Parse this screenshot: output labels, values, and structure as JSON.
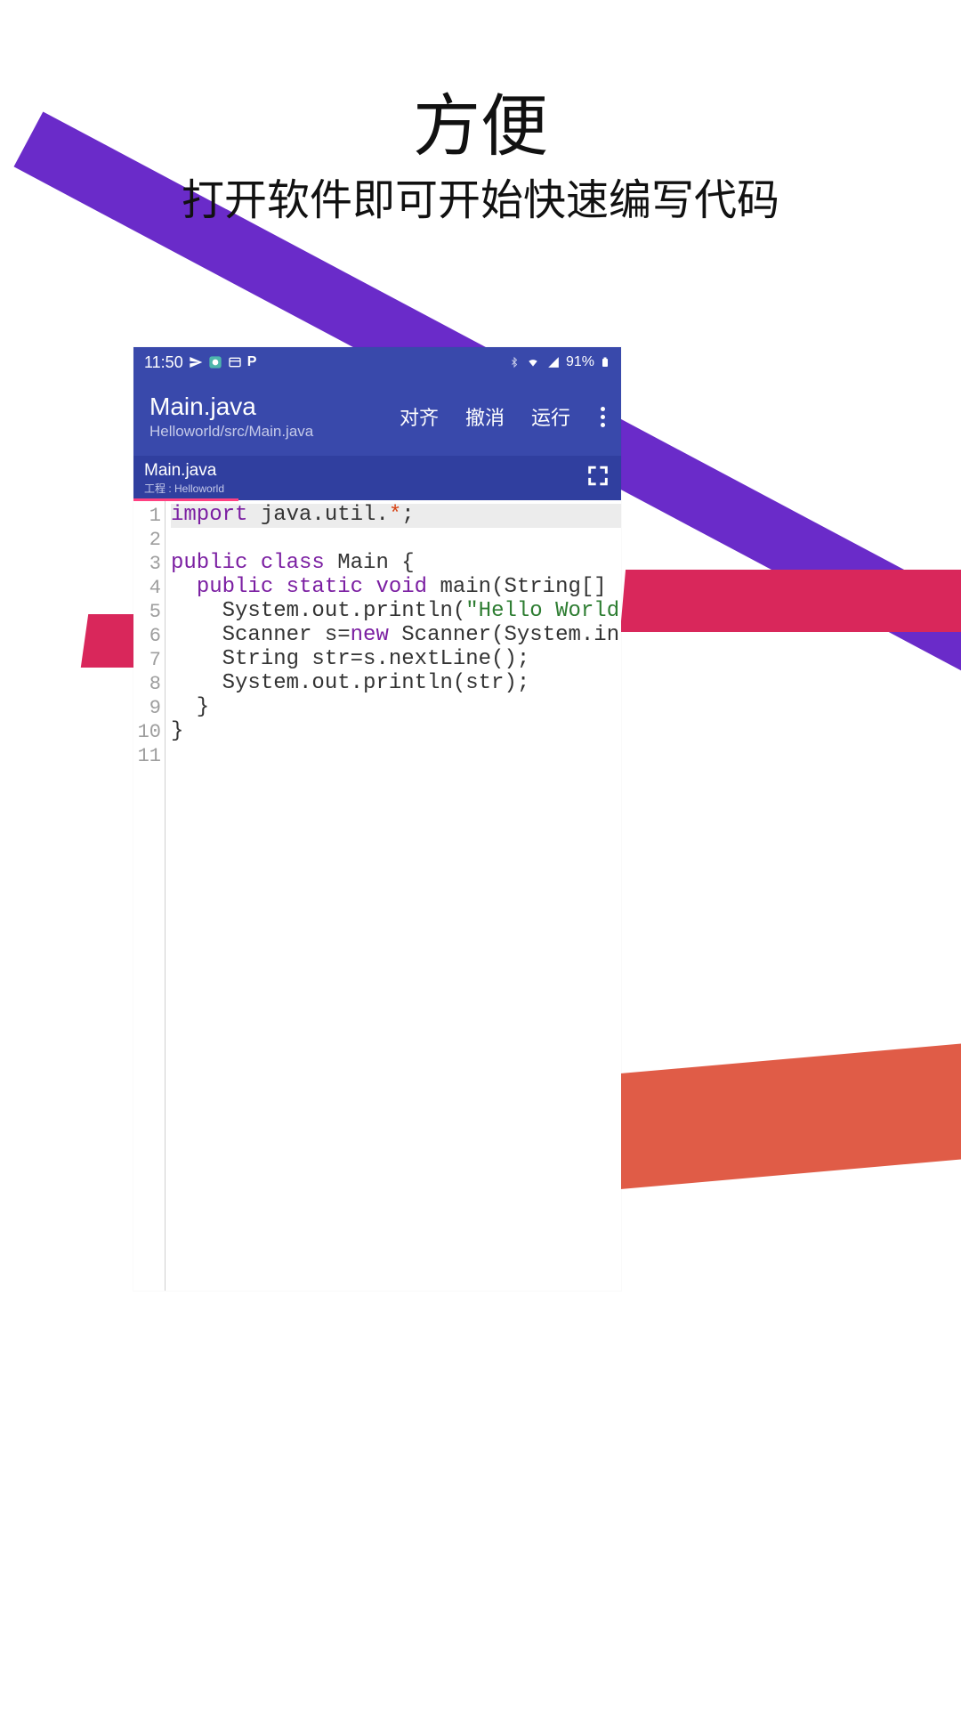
{
  "promo": {
    "title": "方便",
    "subtitle": "打开软件即可开始快速编写代码"
  },
  "status": {
    "time": "11:50",
    "battery": "91%"
  },
  "appbar": {
    "title": "Main.java",
    "path": "Helloworld/src/Main.java",
    "align": "对齐",
    "undo": "撤消",
    "run": "运行"
  },
  "tab": {
    "name": "Main.java",
    "project_label": "工程 : Helloworld"
  },
  "editor": {
    "line_numbers": [
      "1",
      "2",
      "3",
      "4",
      "5",
      "6",
      "7",
      "8",
      "9",
      "10",
      "11"
    ],
    "lines": [
      {
        "segments": [
          {
            "t": "import",
            "c": "kw"
          },
          {
            "t": " java.util.",
            "c": "plain"
          },
          {
            "t": "*",
            "c": "op"
          },
          {
            "t": ";",
            "c": "plain"
          }
        ],
        "current": true
      },
      {
        "segments": []
      },
      {
        "segments": [
          {
            "t": "public class",
            "c": "kw"
          },
          {
            "t": " Main {",
            "c": "plain"
          }
        ]
      },
      {
        "segments": [
          {
            "t": "  ",
            "c": "plain"
          },
          {
            "t": "public static void",
            "c": "kw"
          },
          {
            "t": " main(String[]",
            "c": "plain"
          }
        ]
      },
      {
        "segments": [
          {
            "t": "    System.out.println(",
            "c": "plain"
          },
          {
            "t": "\"Hello World",
            "c": "str"
          }
        ]
      },
      {
        "segments": [
          {
            "t": "    Scanner s=",
            "c": "plain"
          },
          {
            "t": "new",
            "c": "kw"
          },
          {
            "t": " Scanner(System.in",
            "c": "plain"
          }
        ]
      },
      {
        "segments": [
          {
            "t": "    String str=s.nextLine();",
            "c": "plain"
          }
        ]
      },
      {
        "segments": [
          {
            "t": "    System.out.println(str);",
            "c": "plain"
          }
        ]
      },
      {
        "segments": [
          {
            "t": "  }",
            "c": "plain"
          }
        ]
      },
      {
        "segments": [
          {
            "t": "}",
            "c": "plain"
          }
        ]
      },
      {
        "segments": []
      }
    ]
  }
}
